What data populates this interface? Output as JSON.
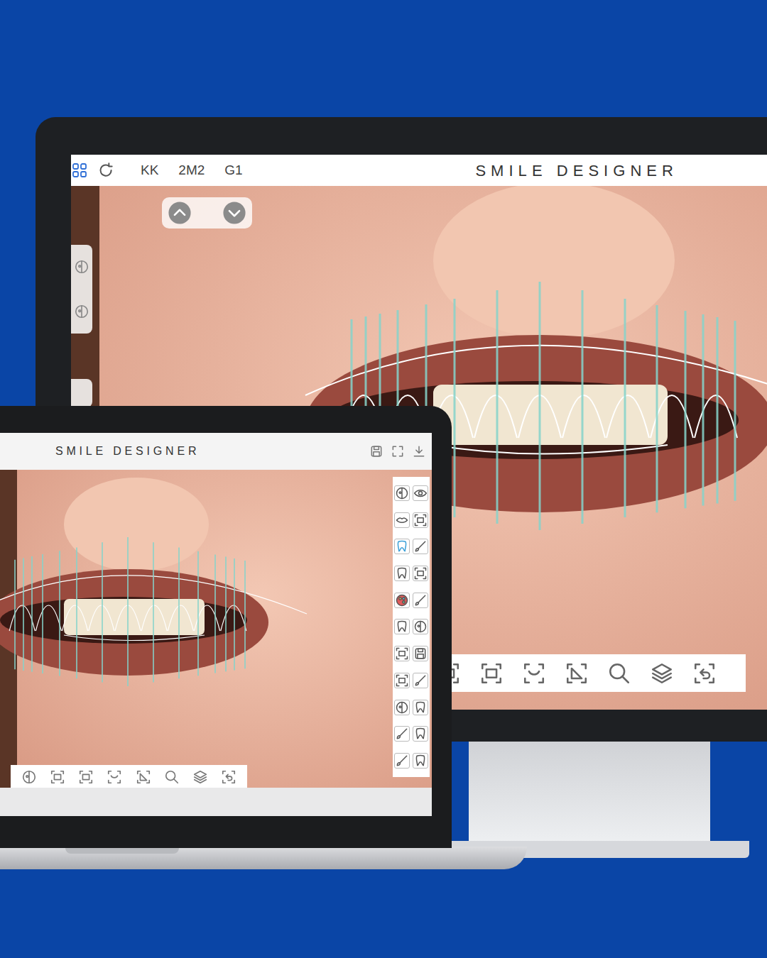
{
  "monitor": {
    "toolbar": {
      "labels": [
        "KK",
        "2M2",
        "G1"
      ],
      "title": "SMILE DESIGNER"
    }
  },
  "laptop": {
    "header": {
      "title": "SMILE DESIGNER"
    }
  }
}
